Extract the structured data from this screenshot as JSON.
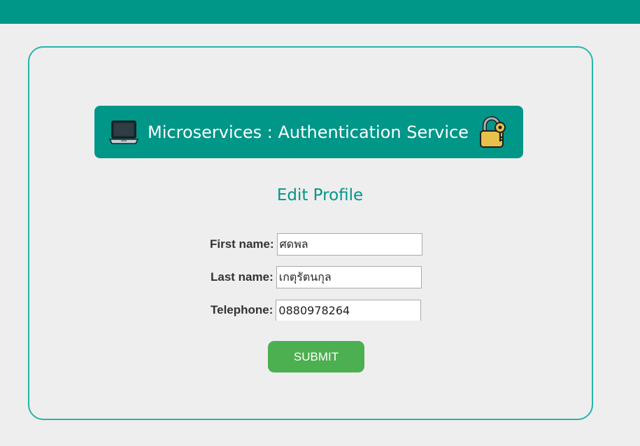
{
  "banner": {
    "title": "Microservices : Authentication Service",
    "left_icon": "laptop-icon",
    "right_icon": "lock-with-key-icon"
  },
  "form": {
    "title": "Edit Profile",
    "first_name": {
      "label": "First name:",
      "value": "ศดพล"
    },
    "last_name": {
      "label": "Last name:",
      "value": "เกตุรัตนกุล"
    },
    "telephone": {
      "label": "Telephone:",
      "value": "0880978264"
    },
    "submit_label": "SUBMIT"
  },
  "colors": {
    "primary": "#009688",
    "card_border": "#26b5a8",
    "submit": "#4caf50",
    "background": "#eeeeee"
  }
}
